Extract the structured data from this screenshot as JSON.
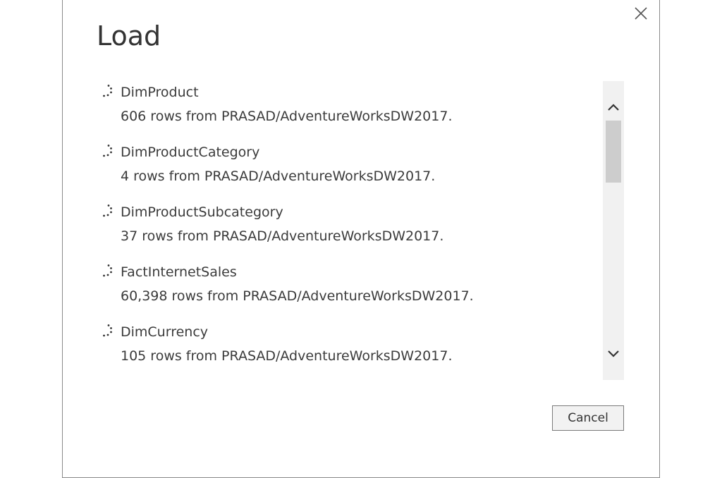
{
  "dialog": {
    "title": "Load",
    "cancel_label": "Cancel",
    "close_icon": "close-icon"
  },
  "items": [
    {
      "name": "DimProduct",
      "description": "606 rows from PRASAD/AdventureWorksDW2017.",
      "icon": "loading-spinner-icon"
    },
    {
      "name": "DimProductCategory",
      "description": "4 rows from PRASAD/AdventureWorksDW2017.",
      "icon": "loading-spinner-icon"
    },
    {
      "name": "DimProductSubcategory",
      "description": "37 rows from PRASAD/AdventureWorksDW2017.",
      "icon": "loading-spinner-icon"
    },
    {
      "name": "FactInternetSales",
      "description": "60,398 rows from PRASAD/AdventureWorksDW2017.",
      "icon": "loading-spinner-icon"
    },
    {
      "name": "DimCurrency",
      "description": "105 rows from PRASAD/AdventureWorksDW2017.",
      "icon": "loading-spinner-icon"
    }
  ],
  "colors": {
    "text": "#3b3b3b",
    "scrollbar_track": "#f1f1f1",
    "scrollbar_thumb": "#cdcdcd",
    "button_bg": "#f2f2f2"
  }
}
